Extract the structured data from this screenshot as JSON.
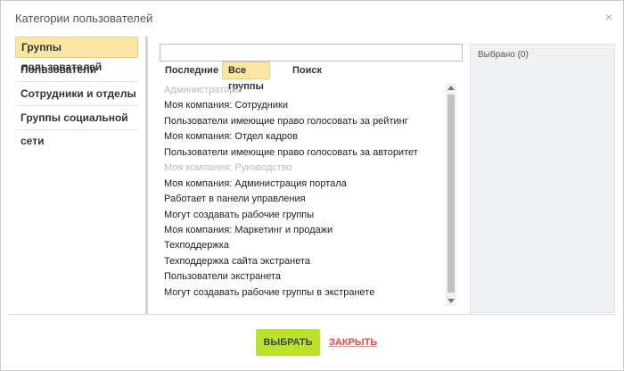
{
  "dialog": {
    "title": "Категории пользователей",
    "close_icon": "×"
  },
  "sidebar": {
    "items": [
      {
        "label": "Группы пользователей",
        "active": true
      },
      {
        "label": "Пользователи",
        "active": false
      },
      {
        "label": "Сотрудники и отделы",
        "active": false
      },
      {
        "label": "Группы социальной сети",
        "active": false
      }
    ]
  },
  "search": {
    "value": "",
    "placeholder": ""
  },
  "tabs": [
    {
      "label": "Последние",
      "active": false
    },
    {
      "label": "Все группы",
      "active": true
    },
    {
      "label": "Поиск",
      "active": false
    }
  ],
  "groups": [
    {
      "label": "Администраторы",
      "disabled": true
    },
    {
      "label": "Моя компания: Сотрудники",
      "disabled": false
    },
    {
      "label": "Пользователи имеющие право голосовать за рейтинг",
      "disabled": false
    },
    {
      "label": "Моя компания: Отдел кадров",
      "disabled": false
    },
    {
      "label": "Пользователи имеющие право голосовать за авторитет",
      "disabled": false
    },
    {
      "label": "Моя компания: Руководство",
      "disabled": true
    },
    {
      "label": "Моя компания: Администрация портала",
      "disabled": false
    },
    {
      "label": "Работает в панели управления",
      "disabled": false
    },
    {
      "label": "Могут создавать рабочие группы",
      "disabled": false
    },
    {
      "label": "Моя компания: Маркетинг и продажи",
      "disabled": false
    },
    {
      "label": "Техподдержка",
      "disabled": false
    },
    {
      "label": "Техподдержка сайта экстранета",
      "disabled": false
    },
    {
      "label": "Пользователи экстранета",
      "disabled": false
    },
    {
      "label": "Могут создавать рабочие группы в экстранете",
      "disabled": false
    }
  ],
  "selected": {
    "label": "Выбрано (0)"
  },
  "footer": {
    "select_label": "ВЫБРАТЬ",
    "close_label": "ЗАКРЫТЬ"
  },
  "colors": {
    "accent_active": "#fbe7a5",
    "select_button": "#bde22b",
    "close_link": "#d84b4b"
  }
}
